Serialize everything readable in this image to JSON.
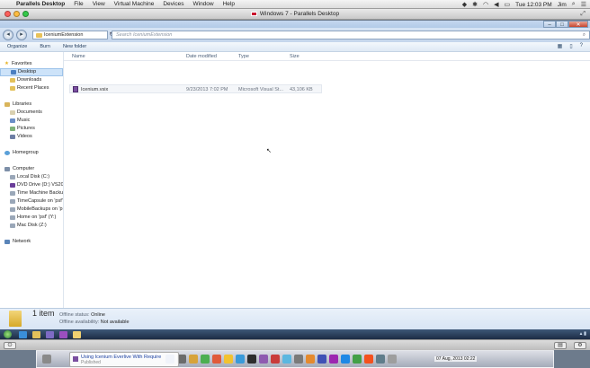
{
  "mac_menubar": {
    "app_name": "Parallels Desktop",
    "menus": [
      "File",
      "View",
      "Virtual Machine",
      "Devices",
      "Window",
      "Help"
    ],
    "clock": "Tue 12:03 PM",
    "user": "Jim"
  },
  "parallels_window": {
    "title": "Windows 7 - Parallels Desktop"
  },
  "explorer": {
    "breadcrumb": "IceniumExtension",
    "search_placeholder": "Search IceniumExtension",
    "commands": [
      "Organize",
      "Burn",
      "New folder"
    ],
    "nav": {
      "favorites": {
        "label": "Favorites",
        "items": [
          "Desktop",
          "Downloads",
          "Recent Places"
        ]
      },
      "libraries": {
        "label": "Libraries",
        "items": [
          "Documents",
          "Music",
          "Pictures",
          "Videos"
        ]
      },
      "homegroup": "Homegroup",
      "computer": {
        "label": "Computer",
        "items": [
          "Local Disk (C:)",
          "DVD Drive (D:) VS201",
          "Time Machine Backup",
          "TimeCapsule on 'psf'",
          "MobileBackups on 'p",
          "Home on 'psf' (Y:)",
          "Mac Disk (Z:)"
        ]
      },
      "network": "Network"
    },
    "columns": [
      "Name",
      "Date modified",
      "Type",
      "Size"
    ],
    "files": [
      {
        "name": "Icenium.vsix",
        "date": "9/23/2013 7:02 PM",
        "type": "Microsoft Visual St...",
        "size": "43,106 KB"
      }
    ],
    "details": {
      "count": "1 item",
      "offline_status_label": "Offline status:",
      "offline_status_value": "Online",
      "offline_availability_label": "Offline availability:",
      "offline_availability_value": "Not available"
    }
  },
  "dock": {
    "notification_title": "Using Icenium Everlive With Require",
    "notification_sub": "Published",
    "date": "07 Aug, 2013 02:22"
  }
}
